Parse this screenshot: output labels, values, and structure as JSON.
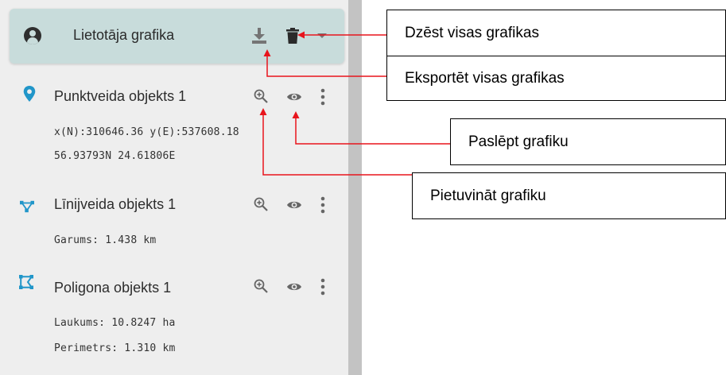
{
  "header": {
    "title": "Lietotāja grafika"
  },
  "items": [
    {
      "title": "Punktveida objekts 1",
      "details": [
        "x(N):310646.36 y(E):537608.18",
        "56.93793N 24.61806E"
      ]
    },
    {
      "title": "Līnijveida objekts 1",
      "details": [
        "Garums: 1.438 km"
      ]
    },
    {
      "title": "Poligona objekts 1",
      "details": [
        "Laukums: 10.8247 ha",
        "Perimetrs: 1.310 km"
      ]
    }
  ],
  "callouts": {
    "delete_all": "Dzēst visas grafikas",
    "export_all": "Eksportēt visas grafikas",
    "hide": "Paslēpt grafiku",
    "zoom": "Pietuvināt grafiku"
  },
  "colors": {
    "accent": "#2196c9",
    "header_bg": "#c8dcdb",
    "arrow": "#e8141c"
  }
}
